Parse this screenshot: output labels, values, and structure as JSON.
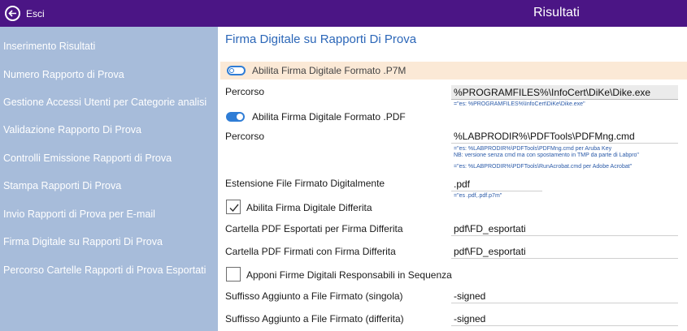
{
  "topbar": {
    "exit_label": "Esci",
    "title": "Risultati"
  },
  "sidebar": {
    "items": [
      "Inserimento Risultati",
      "Numero Rapporto di Prova",
      "Gestione Accessi Utenti per Categorie analisi",
      "Validazione Rapporto Di Prova",
      "Controlli  Emissione Rapporti di Prova",
      "Stampa Rapporti Di Prova",
      "Invio Rapporti di Prova per E-mail",
      "Firma Digitale su Rapporti Di Prova",
      "Percorso Cartelle Rapporti di Prova Esportati"
    ]
  },
  "main": {
    "title": "Firma Digitale su Rapporti Di Prova",
    "p7m": {
      "label": "Abilita Firma Digitale Formato .P7M",
      "enabled": false,
      "path_label": "Percorso",
      "path_value": "%PROGRAMFILES%\\InfoCert\\DiKe\\Dike.exe",
      "path_hint": "=\"es: %PROGRAMFILES%\\InfoCert\\DiKe\\Dike.exe\""
    },
    "pdf": {
      "label": "Abilita Firma Digitale Formato .PDF",
      "enabled": true,
      "path_label": "Percorso",
      "path_value": "%LABPRODIR%\\PDFTools\\PDFMng.cmd",
      "hint1": "=\"es: %LABPRODIR%\\PDFTools\\PDFMng.cmd  per Aruba Key",
      "hint2": "NB: versione senza cmd ma con spostamento in TMP da parte di Labpro\"",
      "hint3": "=\"es: %LABPRODIR%\\PDFTools\\RunAcrobat.cmd  per Adobe Acrobat\""
    },
    "extension": {
      "label": "Estensione File Firmato Digitalmente",
      "value": ".pdf",
      "hint": "=\"es .pdf,.pdf.p7m\""
    },
    "deferred": {
      "label": "Abilita Firma Digitale Differita",
      "checked": true,
      "export_folder_label": "Cartella PDF Esportati per Firma Differita",
      "export_folder_value": "pdf\\FD_esportati",
      "signed_folder_label": "Cartella PDF Firmati con Firma Differita",
      "signed_folder_value": "pdf\\FD_esportati"
    },
    "sequence": {
      "label": "Apponi Firme Digitali Responsabili in Sequenza",
      "checked": false
    },
    "suffix_single": {
      "label": "Suffisso Aggiunto a File Firmato (singola)",
      "value": "-signed"
    },
    "suffix_deferred": {
      "label": "Suffisso Aggiunto a File Firmato (differita)",
      "value": "-signed"
    }
  },
  "colors": {
    "topbar": "#4b1585",
    "sidebar": "#a7bcda",
    "accent": "#2f7dd6",
    "title": "#2c67b8",
    "highlight_row": "#fbe9d6"
  }
}
